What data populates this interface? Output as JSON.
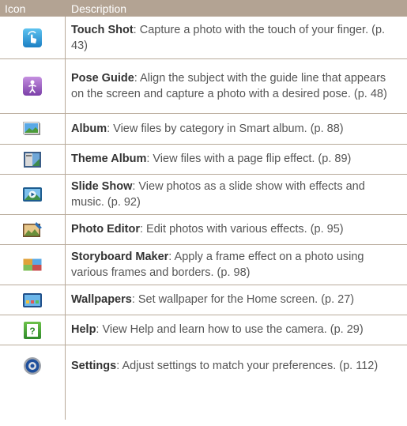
{
  "header": {
    "col_icon": "Icon",
    "col_description": "Description"
  },
  "rows": [
    {
      "icon": "touch-shot-icon",
      "title": "Touch Shot",
      "text": ": Capture a photo with the touch of your finger. (p. 43)"
    },
    {
      "icon": "pose-guide-icon",
      "title": "Pose Guide",
      "text": ": Align the subject with the guide line that appears on the screen and capture a photo with a desired pose. (p. 48)"
    },
    {
      "icon": "album-icon",
      "title": "Album",
      "text": ": View files by category in Smart album. (p. 88)"
    },
    {
      "icon": "theme-album-icon",
      "title": "Theme Album",
      "text": ": View files with a page flip effect. (p. 89)"
    },
    {
      "icon": "slide-show-icon",
      "title": "Slide Show",
      "text": ": View photos as a slide show with effects and music. (p. 92)"
    },
    {
      "icon": "photo-editor-icon",
      "title": "Photo Editor",
      "text": ": Edit photos with various effects. (p. 95)"
    },
    {
      "icon": "storyboard-maker-icon",
      "title": "Storyboard Maker",
      "text": ": Apply a frame effect on a photo using various frames and borders. (p. 98)"
    },
    {
      "icon": "wallpapers-icon",
      "title": "Wallpapers",
      "text": ": Set wallpaper for the Home screen. (p. 27)"
    },
    {
      "icon": "help-icon",
      "title": "Help",
      "text": ": View Help and learn how to use the camera. (p. 29)"
    },
    {
      "icon": "settings-icon",
      "title": "Settings",
      "text": ": Adjust settings to match your preferences. (p. 112)"
    }
  ],
  "colors": {
    "header_bg": "#b3a393",
    "rule": "#b8aa9a"
  }
}
